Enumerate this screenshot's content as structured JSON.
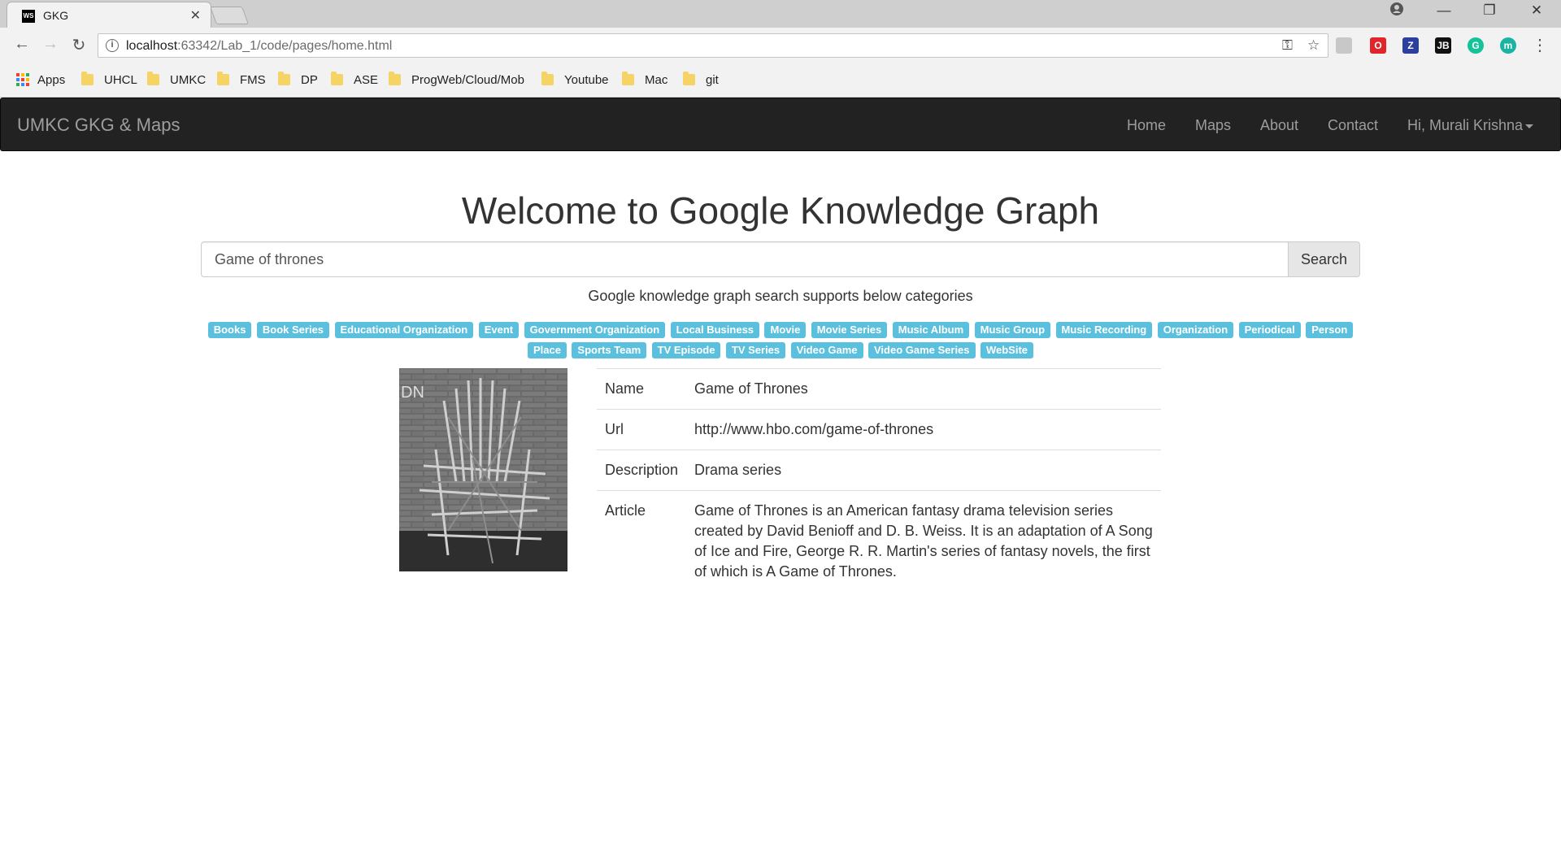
{
  "browser": {
    "tab_title": "GKG",
    "tab_favicon_text": "WS",
    "url_host": "localhost",
    "url_rest": ":63342/Lab_1/code/pages/home.html",
    "bookmarks": [
      {
        "label": "Apps",
        "type": "apps"
      },
      {
        "label": "UHCL",
        "type": "folder"
      },
      {
        "label": "UMKC",
        "type": "folder"
      },
      {
        "label": "FMS",
        "type": "folder"
      },
      {
        "label": "DP",
        "type": "folder"
      },
      {
        "label": "ASE",
        "type": "folder"
      },
      {
        "label": "ProgWeb/Cloud/Mob",
        "type": "folder"
      },
      {
        "label": "Youtube",
        "type": "folder"
      },
      {
        "label": "Mac",
        "type": "folder"
      },
      {
        "label": "git",
        "type": "folder"
      }
    ],
    "extensions": [
      {
        "name": "pdf-extension-icon",
        "color": "#c8c8c8",
        "text": ""
      },
      {
        "name": "opera-extension-icon",
        "color": "#e0262a",
        "text": "O"
      },
      {
        "name": "zotero-extension-icon",
        "color": "#2b3f9e",
        "text": "Z"
      },
      {
        "name": "jetbrains-extension-icon",
        "color": "#111111",
        "text": "JB"
      },
      {
        "name": "grammarly-extension-icon",
        "color": "#15c39a",
        "text": "G"
      },
      {
        "name": "mixmax-extension-icon",
        "color": "#1ab4a3",
        "text": "m"
      }
    ]
  },
  "navbar": {
    "brand": "UMKC GKG & Maps",
    "links": [
      "Home",
      "Maps",
      "About",
      "Contact"
    ],
    "user": "Hi, Murali Krishna"
  },
  "main": {
    "title": "Welcome to Google Knowledge Graph",
    "search_value": "Game of thrones",
    "search_button": "Search",
    "subtitle": "Google knowledge graph search supports below categories",
    "categories": [
      "Books",
      "Book Series",
      "Educational Organization",
      "Event",
      "Government Organization",
      "Local Business",
      "Movie",
      "Movie Series",
      "Music Album",
      "Music Group",
      "Music Recording",
      "Organization",
      "Periodical",
      "Person",
      "Place",
      "Sports Team",
      "TV Episode",
      "TV Series",
      "Video Game",
      "Video Game Series",
      "WebSite"
    ],
    "result": [
      {
        "key": "Name",
        "value": "Game of Thrones"
      },
      {
        "key": "Url",
        "value": "http://www.hbo.com/game-of-thrones"
      },
      {
        "key": "Description",
        "value": "Drama series"
      },
      {
        "key": "Article",
        "value": "Game of Thrones is an American fantasy drama television series created by David Benioff and D. B. Weiss. It is an adaptation of A Song of Ice and Fire, George R. R. Martin's series of fantasy novels, the first of which is A Game of Thrones."
      }
    ]
  },
  "colors": {
    "label_bg": "#5bc0de",
    "navbar_bg": "#222222",
    "navbar_text": "#9d9d9d"
  }
}
